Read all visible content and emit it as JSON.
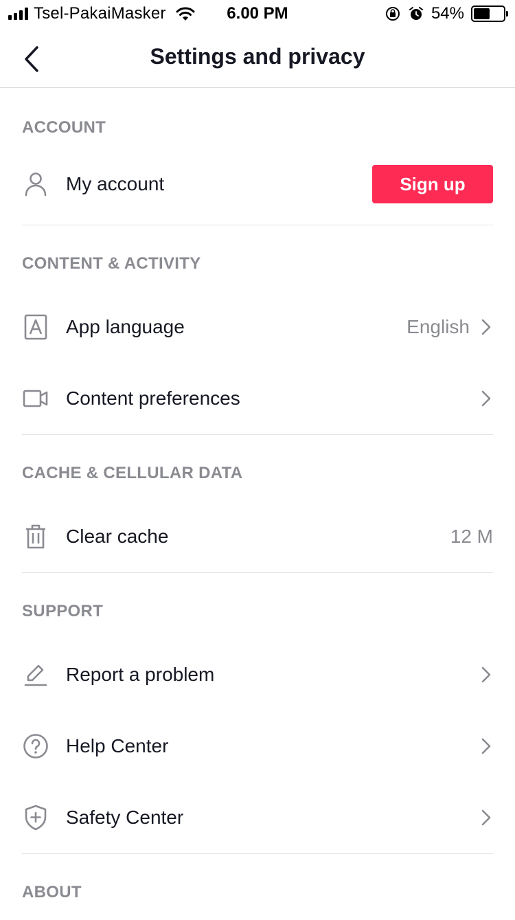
{
  "status_bar": {
    "carrier": "Tsel-PakaiMasker",
    "time": "6.00 PM",
    "battery_percent": "54%",
    "battery_level": 0.54
  },
  "header": {
    "title": "Settings and privacy"
  },
  "sections": {
    "account": {
      "title": "ACCOUNT",
      "my_account": {
        "label": "My account",
        "icon": "person-icon",
        "button": "Sign up"
      }
    },
    "content_activity": {
      "title": "CONTENT & ACTIVITY",
      "app_language": {
        "label": "App language",
        "value": "English",
        "icon": "language-icon"
      },
      "content_preferences": {
        "label": "Content preferences",
        "icon": "video-camera-icon"
      }
    },
    "cache": {
      "title": "CACHE & CELLULAR DATA",
      "clear_cache": {
        "label": "Clear cache",
        "value": "12 M",
        "icon": "trash-icon"
      }
    },
    "support": {
      "title": "SUPPORT",
      "report_problem": {
        "label": "Report a problem",
        "icon": "pencil-icon"
      },
      "help_center": {
        "label": "Help Center",
        "icon": "question-circle-icon"
      },
      "safety_center": {
        "label": "Safety Center",
        "icon": "shield-plus-icon"
      }
    },
    "about": {
      "title": "ABOUT"
    }
  },
  "colors": {
    "accent": "#fe2c55",
    "text": "#161823",
    "muted": "#8a8b91",
    "divider": "#e3e3e4"
  }
}
